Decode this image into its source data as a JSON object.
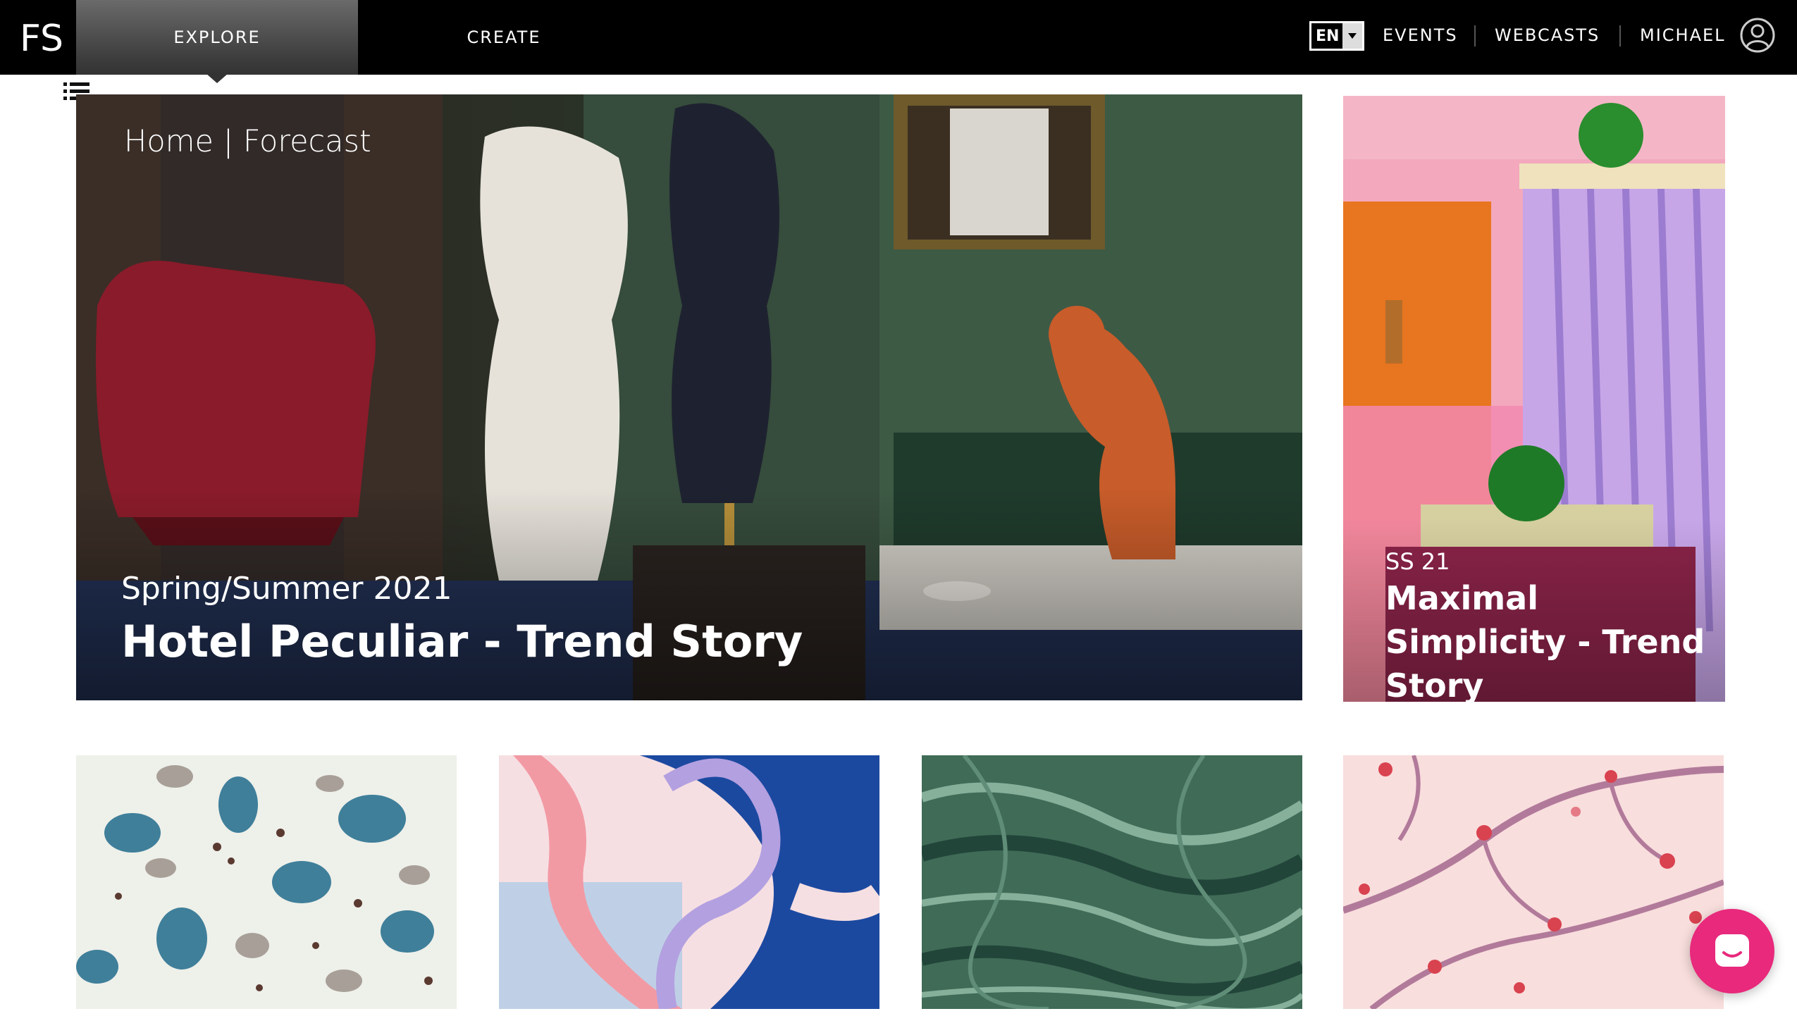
{
  "header": {
    "logo_text": "FS",
    "tabs": [
      {
        "label": "EXPLORE",
        "active": true
      },
      {
        "label": "CREATE",
        "active": false
      }
    ],
    "language": "EN",
    "links": [
      {
        "label": "EVENTS"
      },
      {
        "label": "WEBCASTS"
      }
    ],
    "user_name": "MICHAEL",
    "icons": {
      "menu": "list-icon",
      "avatar": "user-circle-icon",
      "chat": "chat-icon"
    }
  },
  "hero": {
    "breadcrumb": {
      "home": "Home",
      "separator": "|",
      "current": "Forecast"
    },
    "season": "Spring/Summer 2021",
    "title": "Hotel Peculiar - Trend Story"
  },
  "side_card": {
    "season": "SS 21",
    "title": "Maximal Simplicity - Trend Story"
  },
  "tiles": [
    {
      "pattern": "terrazzo-spots",
      "colors": [
        "#eef0ea",
        "#3f7f9a",
        "#a8a098",
        "#5a3a30"
      ]
    },
    {
      "pattern": "abstract-ribbons",
      "colors": [
        "#f6dfe2",
        "#1c49a0",
        "#f29aa4",
        "#b3a0e0"
      ]
    },
    {
      "pattern": "green-marble",
      "colors": [
        "#3f6b57",
        "#86b09a",
        "#22453a"
      ]
    },
    {
      "pattern": "blossom-branches",
      "colors": [
        "#f8dedd",
        "#b27a9a",
        "#d9424f"
      ]
    }
  ],
  "colors": {
    "topbar": "#000000",
    "chat_button": "#e8297c"
  }
}
